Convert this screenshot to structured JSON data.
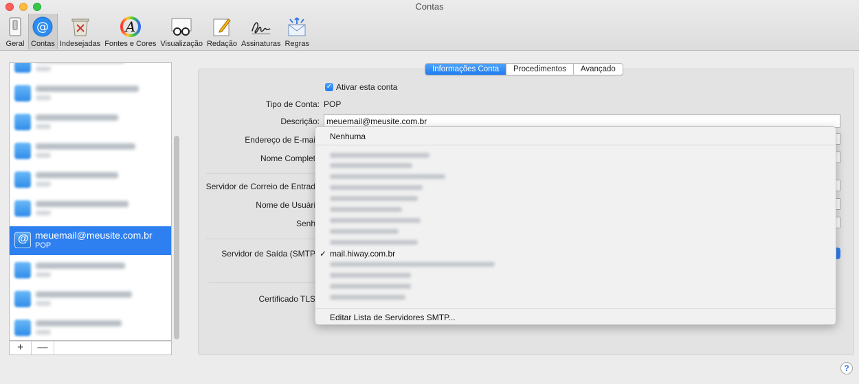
{
  "window": {
    "title": "Contas"
  },
  "toolbar": {
    "items": [
      {
        "label": "Geral",
        "icon": "switch-icon"
      },
      {
        "label": "Contas",
        "icon": "at-sign-icon"
      },
      {
        "label": "Indesejadas",
        "icon": "trash-bin-icon"
      },
      {
        "label": "Fontes e Cores",
        "icon": "colored-a-icon"
      },
      {
        "label": "Visualização",
        "icon": "glasses-icon"
      },
      {
        "label": "Redação",
        "icon": "pencil-notepad-icon"
      },
      {
        "label": "Assinaturas",
        "icon": "signature-icon"
      },
      {
        "label": "Regras",
        "icon": "envelope-arrows-icon"
      }
    ],
    "active_index": 1
  },
  "accounts": {
    "selected": {
      "email": "meuemail@meusite.com.br",
      "type": "POP"
    },
    "footer": {
      "add": "+",
      "remove": "—"
    }
  },
  "tabs": {
    "items": [
      "Informações Conta",
      "Procedimentos",
      "Avançado"
    ],
    "active_index": 0
  },
  "form": {
    "enable_label": "Ativar esta conta",
    "account_type_label": "Tipo de Conta:",
    "account_type_value": "POP",
    "description_label": "Descrição:",
    "description_value": "meuemail@meusite.com.br",
    "email_label": "Endereço de E-mai",
    "fullname_label": "Nome Complet",
    "incoming_label": "Servidor de Correio de Entrad",
    "username_label": "Nome de Usuári",
    "password_label": "Senh",
    "outgoing_label": "Servidor de Saída (SMTP",
    "tls_label": "Certificado TLS"
  },
  "smtp_dropdown": {
    "none": "Nenhuma",
    "selected": "mail.hiway.com.br",
    "checkmark": "✓",
    "edit": "Editar Lista de Servidores SMTP..."
  },
  "help": {
    "label": "?"
  },
  "colors": {
    "accent": "#2e7ff0",
    "selection": "#2e7ff0"
  }
}
